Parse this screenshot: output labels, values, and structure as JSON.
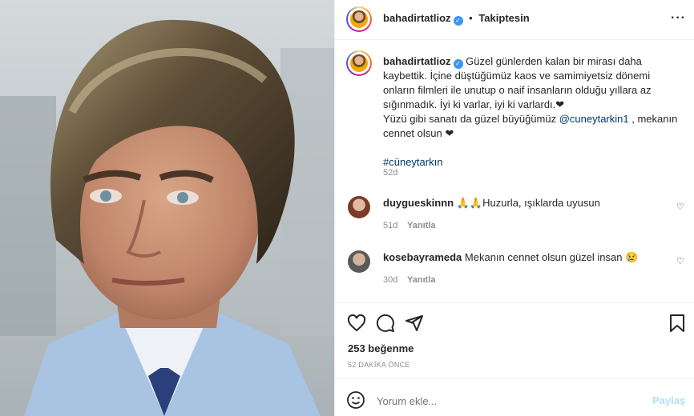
{
  "header": {
    "username": "bahadirtatlioz",
    "dot": "•",
    "follow_status": "Takiptesin",
    "more_icon": "more-icon"
  },
  "caption": {
    "username": "bahadirtatlioz",
    "line1": "Güzel günlerden kalan bir mirası daha",
    "line2": "kaybettik. İçine düştüğümüz kaos ve samimiyetsiz dönemi",
    "line3": "onların filmleri ile unutup o naif insanların olduğu yıllara az",
    "line4": "sığınmadık. İyi ki varlar, iyi ki varlardı.❤",
    "line5a": "Yüzü gibi sanatı da güzel büyüğümüz ",
    "mention": "@cuneytarkin1",
    "line5b": " , mekanın",
    "line6": "cennet olsun ❤",
    "hashtag": "#cüneytarkın",
    "time": "52d"
  },
  "comments": [
    {
      "username": "duygueskinnn",
      "text": "🙏🙏Huzurla, ışıklarda uyusun",
      "time": "51d",
      "reply": "Yanıtla"
    },
    {
      "username": "kosebayrameda",
      "text": "Mekanın cennet olsun güzel insan 😢",
      "time": "30d",
      "reply": "Yanıtla"
    }
  ],
  "actions": {
    "likes": "253 beğenme",
    "timestamp": "52 DAKİKA ÖNCE"
  },
  "comment_box": {
    "placeholder": "Yorum ekle...",
    "post": "Paylaş"
  },
  "colors": {
    "link": "#00376b",
    "verified": "#3897f0",
    "post_disabled": "#b2dffc"
  }
}
